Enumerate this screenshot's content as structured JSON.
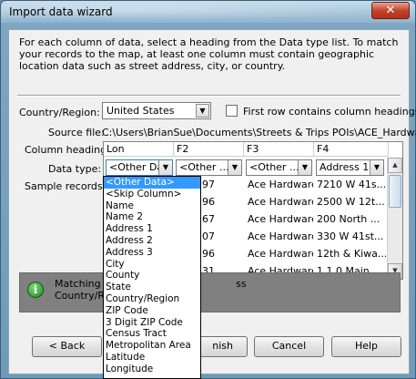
{
  "window": {
    "title": "Import data wizard",
    "close": "✕"
  },
  "intro_text": "For each column of data, select a heading from the Data type list. To match your records to the map, at least one column must contain geographic location data such as street address, city, or country.",
  "country": {
    "label": "Country/Region:",
    "value": "United States"
  },
  "first_row": {
    "label": "First row contains column headings",
    "checked": false
  },
  "source": {
    "label": "Source file:",
    "path": "C:\\Users\\BrianSue\\Documents\\Streets & Trips POIs\\ACE_Hardware"
  },
  "labels": {
    "column_heading": "Column heading:",
    "data_type": "Data type:",
    "sample_records": "Sample records:"
  },
  "columns": [
    {
      "heading": "Lon",
      "data_type": "<Other Da"
    },
    {
      "heading": "F2",
      "data_type": "<Other ..."
    },
    {
      "heading": "F3",
      "data_type": "<Other ..."
    },
    {
      "heading": "F4",
      "data_type": "Address 1"
    }
  ],
  "sample_rows": [
    [
      "97",
      "Ace Hardware",
      "7210 W 41s..."
    ],
    [
      "96",
      "Ace Hardware",
      "2500 W 12t..."
    ],
    [
      "67",
      "Ace Hardware",
      "200 North ..."
    ],
    [
      "07",
      "Ace Hardware",
      "330 W 41st..."
    ],
    [
      "96",
      "Ace Hardware",
      "12th & Kiwa..."
    ],
    [
      "31",
      "Ace Hardware",
      "1 1 0 Main..."
    ]
  ],
  "info": {
    "icon": "info-icon",
    "line1": "Matching re",
    "line1_end": "ss",
    "line2": "Country/Re"
  },
  "buttons": {
    "back": "< Back",
    "finish": "nish",
    "cancel": "Cancel",
    "help": "Help"
  },
  "dropdown_items": [
    "<Other Data>",
    "<Skip Column>",
    "Name",
    "Name 2",
    "Address 1",
    "Address 2",
    "Address 3",
    "City",
    "County",
    "State",
    "Country/Region",
    "ZIP Code",
    "3 Digit ZIP Code",
    "Census Tract",
    "Metropolitan Area",
    "Latitude",
    "Longitude"
  ],
  "dropdown_selected_index": 0
}
